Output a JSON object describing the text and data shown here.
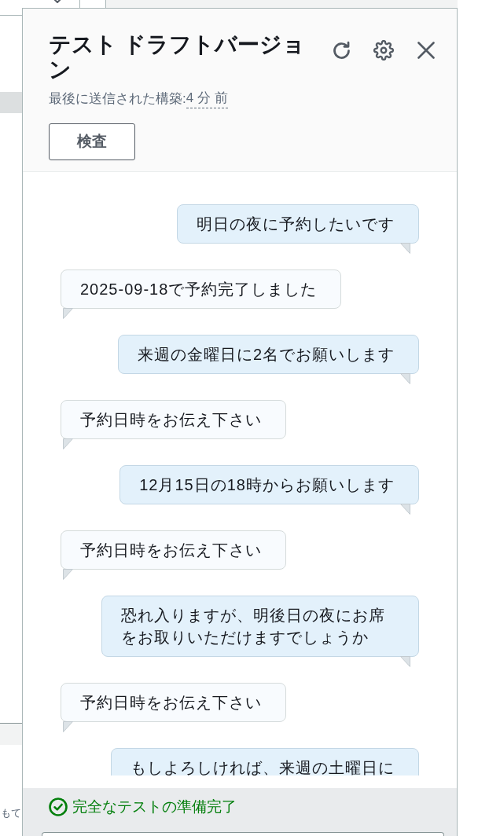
{
  "background": {
    "text": "もて"
  },
  "panel": {
    "title": "テスト ドラフトバージョン",
    "last_build_label": "最後に送信された構築:",
    "last_build_time": "4 分 前",
    "inspect_button": "検査"
  },
  "messages": [
    {
      "kind": "user",
      "text": "明日の夜に予約したいです"
    },
    {
      "kind": "bot",
      "text": "2025-09-18で予約完了しました"
    },
    {
      "kind": "user",
      "text": "来週の金曜日に2名でお願いします"
    },
    {
      "kind": "bot",
      "text": "予約日時をお伝え下さい"
    },
    {
      "kind": "user",
      "text": "12月15日の18時からお願いします"
    },
    {
      "kind": "bot",
      "text": "予約日時をお伝え下さい"
    },
    {
      "kind": "user",
      "text": "恐れ入りますが、明後日の夜にお席をお取りいただけますでしょうか"
    },
    {
      "kind": "bot",
      "text": "予約日時をお伝え下さい"
    },
    {
      "kind": "user",
      "text": "もしよろしければ、来週の土曜日に"
    }
  ],
  "status": {
    "kind": "success",
    "text": "完全なテストの準備完了"
  }
}
